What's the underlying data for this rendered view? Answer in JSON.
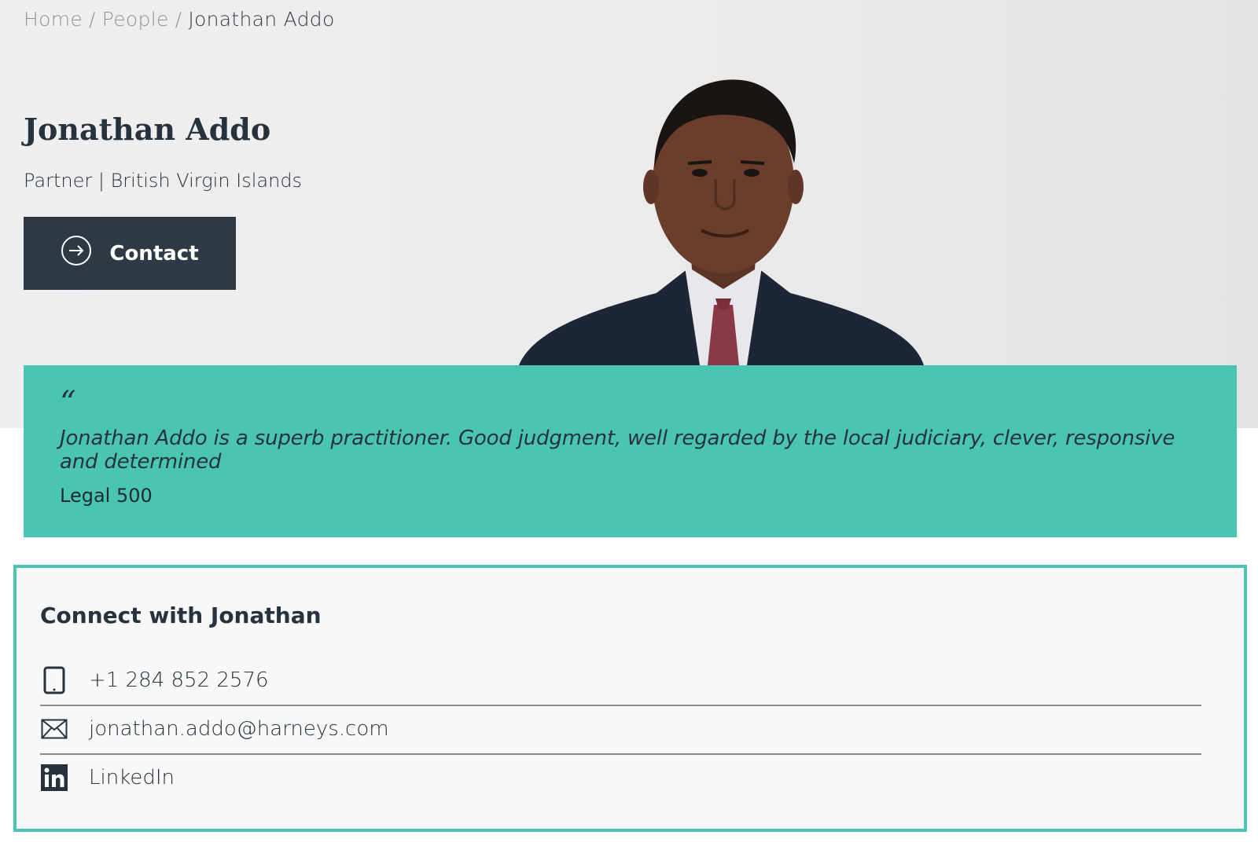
{
  "breadcrumb": {
    "home": "Home",
    "people": "People",
    "current": "Jonathan Addo",
    "separator": "/"
  },
  "profile": {
    "name": "Jonathan Addo",
    "role": "Partner | British Virgin Islands",
    "contact_label": "Contact",
    "photo_description": "headshot-photo"
  },
  "testimonial": {
    "quote_mark": "“",
    "text": "Jonathan Addo is a superb practitioner. Good judgment, well regarded by the local judiciary, clever, responsive and determined",
    "source": "Legal 500"
  },
  "connect": {
    "title": "Connect with Jonathan",
    "items": [
      {
        "icon": "tablet-icon",
        "label": "+1 284 852 2576"
      },
      {
        "icon": "envelope-icon",
        "label": "jonathan.addo@harneys.com"
      },
      {
        "icon": "linkedin-icon",
        "label": "LinkedIn"
      }
    ]
  },
  "colors": {
    "accent_teal": "#49c5b1",
    "navy": "#2d3a46",
    "text_dark": "#26323d",
    "breadcrumb_grey": "#8f9499"
  }
}
